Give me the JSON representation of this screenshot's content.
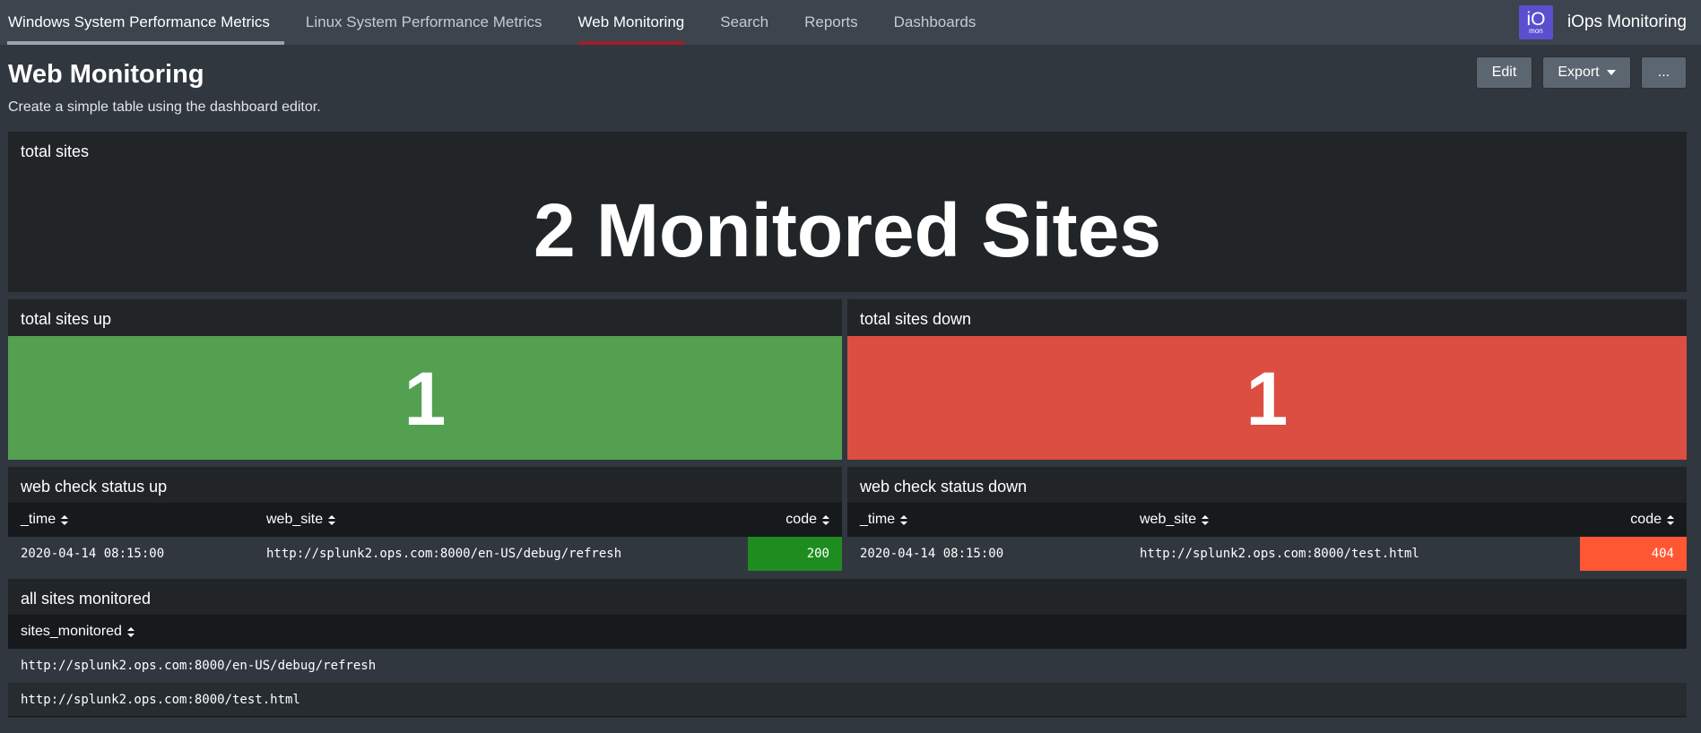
{
  "nav": {
    "items": [
      {
        "label": "Windows System Performance Metrics"
      },
      {
        "label": "Linux System Performance Metrics"
      },
      {
        "label": "Web Monitoring"
      },
      {
        "label": "Search"
      },
      {
        "label": "Reports"
      },
      {
        "label": "Dashboards"
      }
    ],
    "active_item": "Web Monitoring",
    "app_logo_text": "iO",
    "app_logo_subtext": "mon",
    "app_name": "iOps Monitoring"
  },
  "header": {
    "title": "Web Monitoring",
    "description": "Create a simple table using the dashboard editor.",
    "edit_label": "Edit",
    "export_label": "Export",
    "more_label": "..."
  },
  "panels": {
    "total_sites": {
      "title": "total sites",
      "value": "2 Monitored Sites"
    },
    "sites_up": {
      "title": "total sites up",
      "value": "1",
      "color": "#53a051"
    },
    "sites_down": {
      "title": "total sites down",
      "value": "1",
      "color": "#dc4e41"
    },
    "status_up": {
      "title": "web check status up",
      "columns": [
        "_time",
        "web_site",
        "code"
      ],
      "rows": [
        {
          "time": "2020-04-14 08:15:00",
          "web_site": "http://splunk2.ops.com:8000/en-US/debug/refresh",
          "code": "200",
          "code_color": "#1e8c1e"
        }
      ]
    },
    "status_down": {
      "title": "web check status down",
      "columns": [
        "_time",
        "web_site",
        "code"
      ],
      "rows": [
        {
          "time": "2020-04-14 08:15:00",
          "web_site": "http://splunk2.ops.com:8000/test.html",
          "code": "404",
          "code_color": "#ff5733"
        }
      ]
    },
    "all_sites": {
      "title": "all sites monitored",
      "columns": [
        "sites_monitored"
      ],
      "rows": [
        "http://splunk2.ops.com:8000/en-US/debug/refresh",
        "http://splunk2.ops.com:8000/test.html"
      ]
    }
  }
}
